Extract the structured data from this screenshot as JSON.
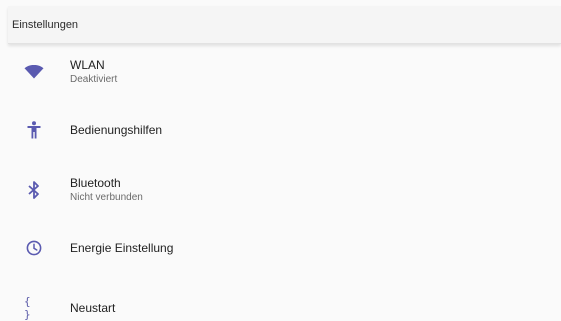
{
  "header": {
    "title": "Einstellungen"
  },
  "colors": {
    "accent": "#5a5ab0",
    "background": "#fafafa",
    "app_bar": "#f5f5f5"
  },
  "settings": {
    "items": [
      {
        "icon": "wifi-icon",
        "label": "WLAN",
        "subtitle": "Deaktiviert"
      },
      {
        "icon": "accessibility-icon",
        "label": "Bedienungshilfen",
        "subtitle": ""
      },
      {
        "icon": "bluetooth-icon",
        "label": "Bluetooth",
        "subtitle": "Nicht verbunden"
      },
      {
        "icon": "clock-icon",
        "label": "Energie Einstellung",
        "subtitle": ""
      },
      {
        "icon": "braces-icon",
        "label": "Neustart",
        "subtitle": ""
      }
    ]
  }
}
